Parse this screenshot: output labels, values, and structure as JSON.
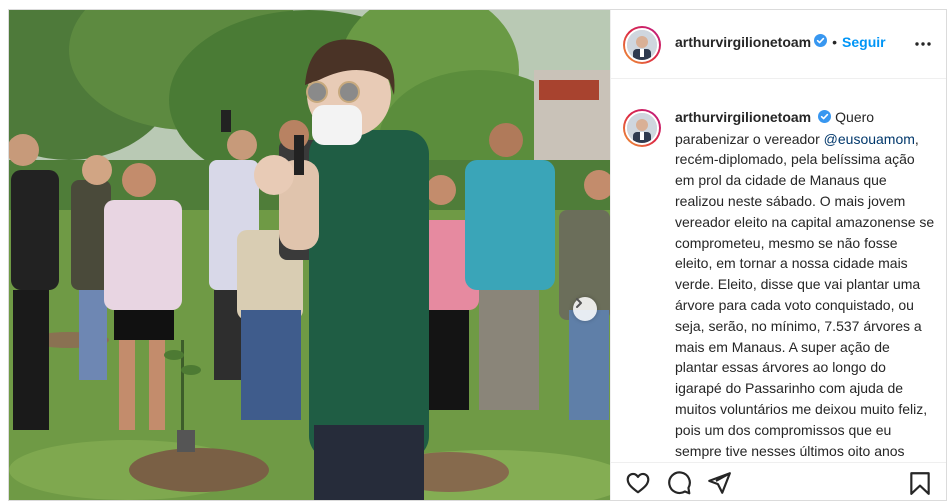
{
  "post": {
    "username": "arthurvirgilionetoam",
    "dot": "•",
    "follow_label": "Seguir",
    "caption_pre": "Quero parabenizar o vereador",
    "caption_mention": "@eusouamom",
    "caption_post": ", recém-diplomado, pela belíssima ação em prol da cidade de Manaus que realizou neste sábado. O mais jovem vereador eleito na capital amazonense se comprometeu, mesmo se não fosse eleito, em tornar a nossa cidade mais verde. Eleito, disse que vai plantar uma árvore para cada voto conquistado, ou seja, serão, no mínimo, 7.537 árvores a mais em Manaus. A super ação de plantar essas árvores ao longo do igarapé do Passarinho com ajuda de muitos voluntários me deixou muito feliz, pois um dos compromissos que eu sempre tive nesses últimos oito anos como prefeito de Manaus foi cuidar do meio ambiente e a ação de Samuel",
    "icons": {
      "verified": "verified-badge-icon",
      "more": "more-options-icon",
      "like": "heart-icon",
      "comment": "comment-icon",
      "share": "share-icon",
      "save": "bookmark-icon",
      "next": "chevron-right-icon"
    }
  },
  "colors": {
    "accent": "#0095f6",
    "mention": "#00376b",
    "text": "#262626",
    "border": "#dbdbdb"
  }
}
